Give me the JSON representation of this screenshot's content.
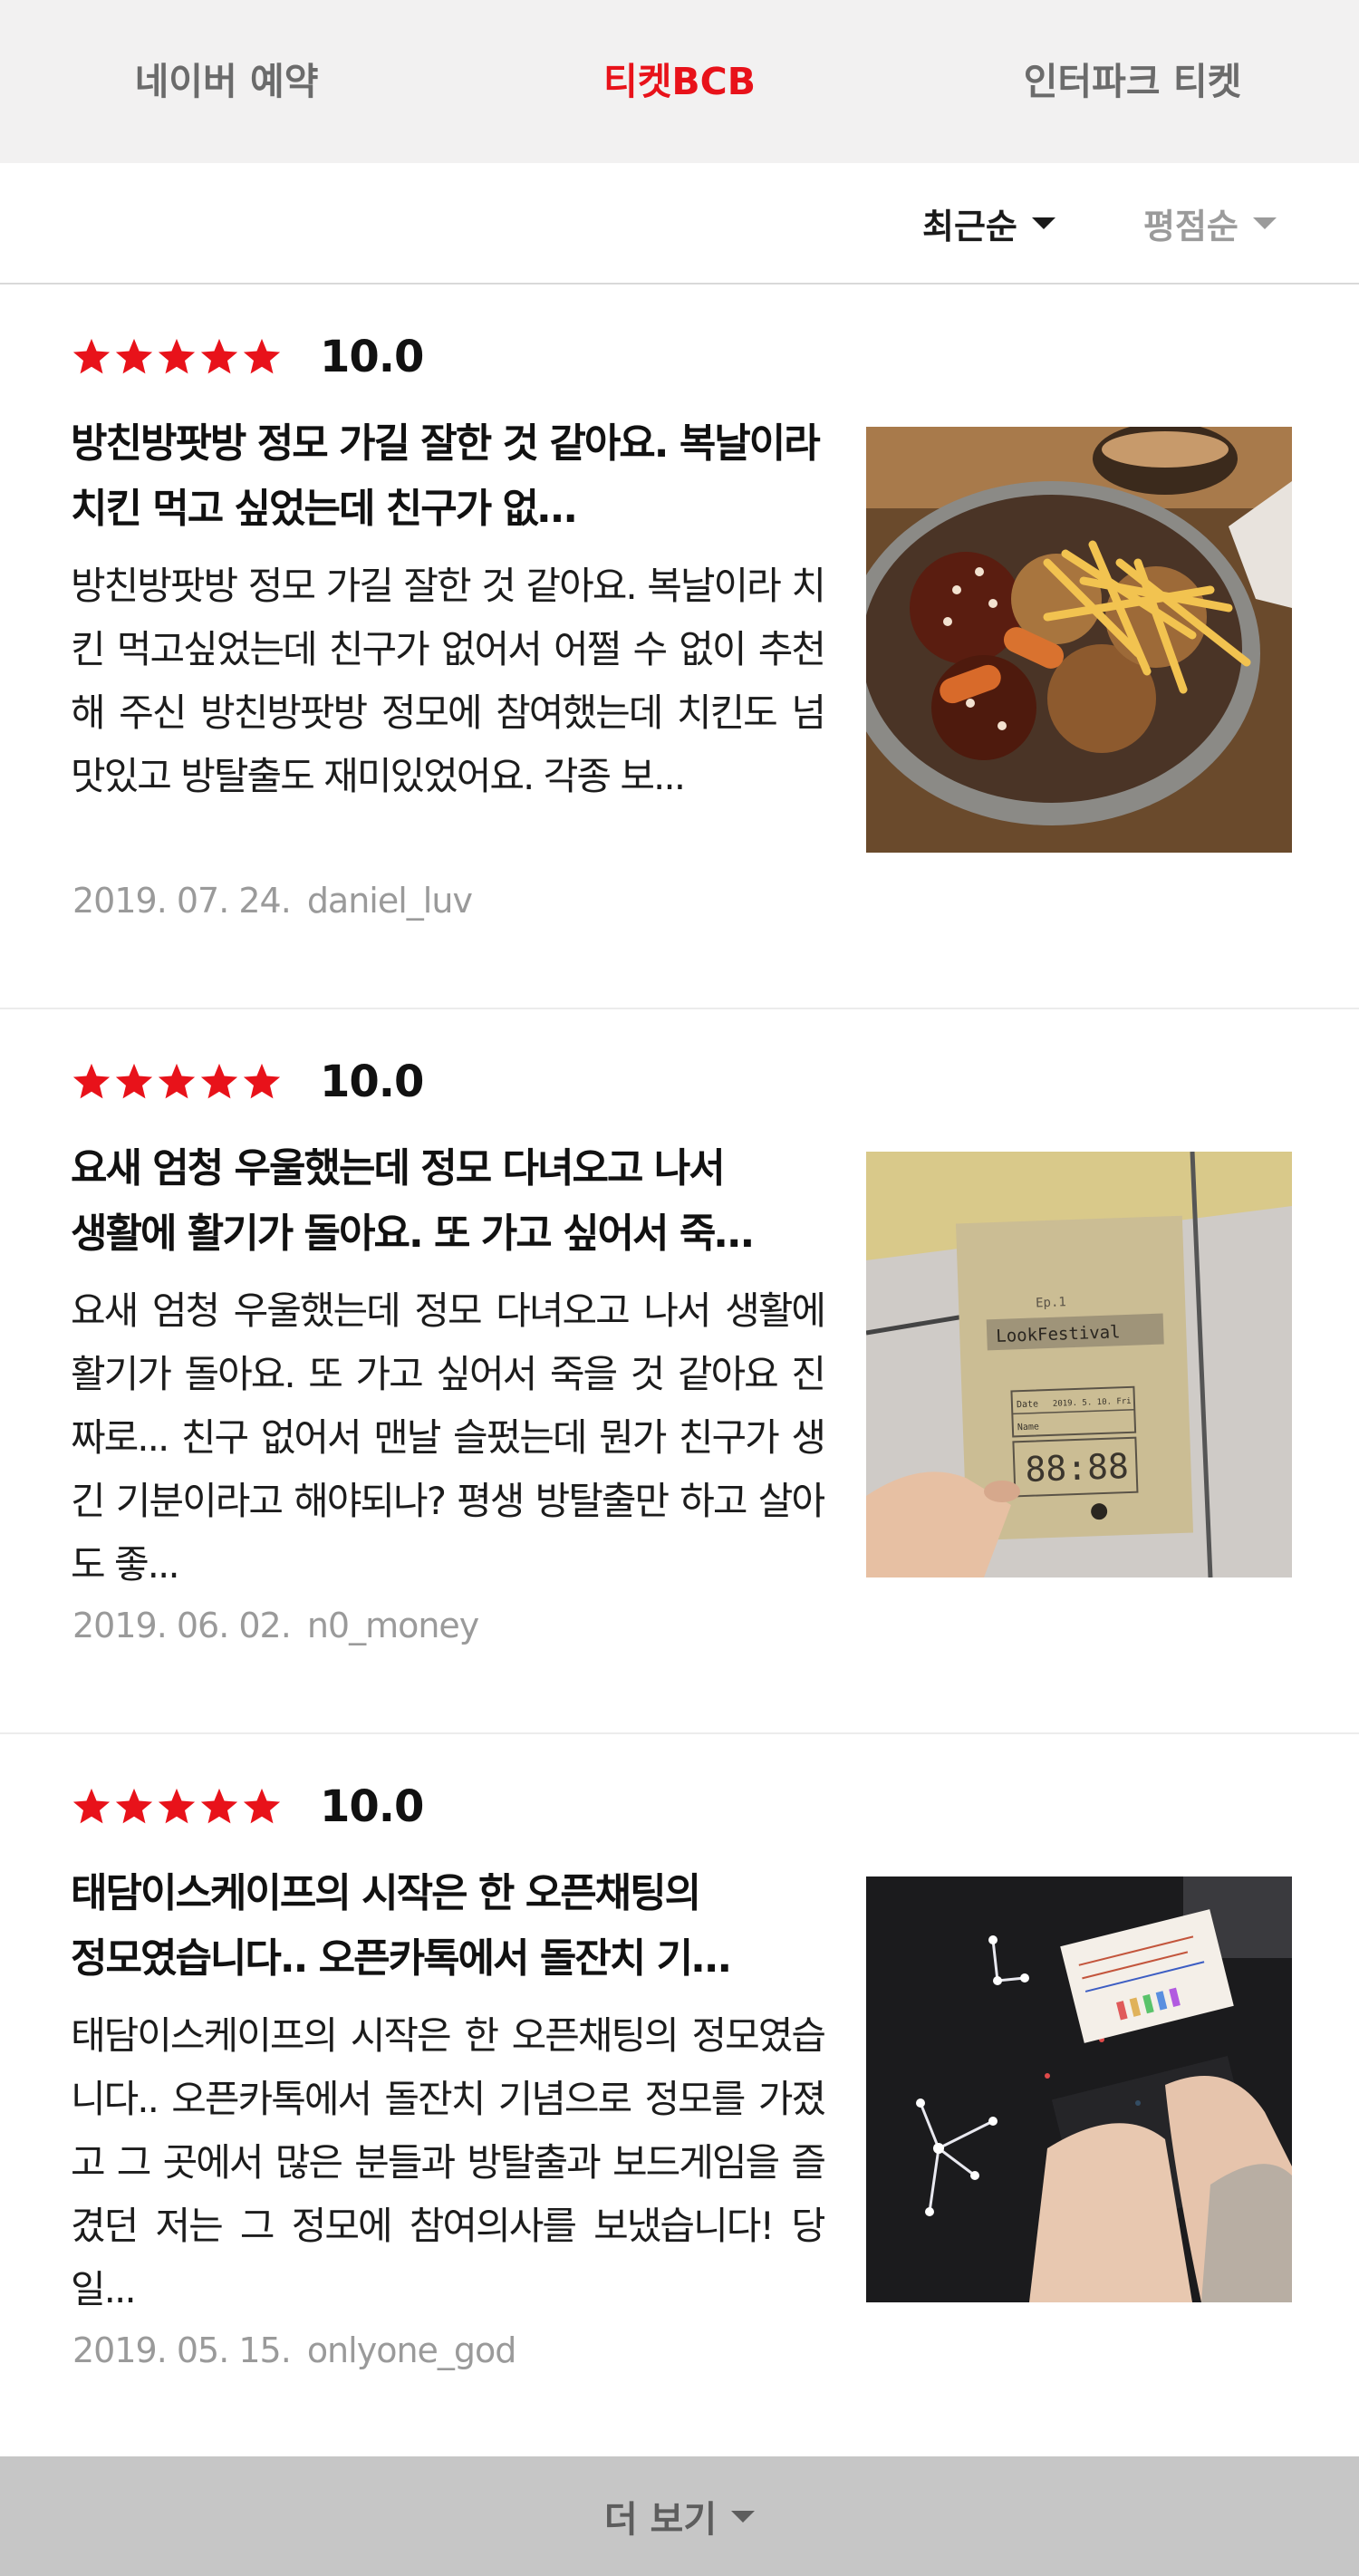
{
  "tabs": [
    {
      "label": "네이버 예약",
      "active": false
    },
    {
      "label": "티켓BCB",
      "active": true
    },
    {
      "label": "인터파크 티켓",
      "active": false
    }
  ],
  "sort": {
    "latest_label": "최근순",
    "rating_label": "평점순",
    "selected": "최근순"
  },
  "colors": {
    "accent": "#e8121a",
    "star": "#e8121a",
    "tab_bg": "#f2f1f1",
    "more_bg": "#c6c6c6"
  },
  "reviews": [
    {
      "stars": 5,
      "score": "10.0",
      "title": "방친방팟방 정모 가길 잘한 것 같아요. 복날이라 치킨 먹고 싶었는데 친구가 없…",
      "body": "방친방팟방 정모 가길 잘한 것 같아요. 복날이라 치킨 먹고싶었는데 친구가 없어서 어쩔 수 없이 추천해 주신 방친방팟방 정모에 참여했는데 치킨도 넘 맛있고 방탈출도 재미있었어요. 각종 보...",
      "date": "2019. 07. 24.",
      "user": "daniel_luv",
      "thumbnail_icon": "chicken-and-fries-photo"
    },
    {
      "stars": 5,
      "score": "10.0",
      "title": "요새 엄청 우울했는데 정모 다녀오고 나서 생활에 활기가 돌아요. 또 가고 싶어서 죽…",
      "body": "요새 엄청 우울했는데 정모 다녀오고 나서 생활에 활기가 돌아요. 또 가고 싶어서 죽을 것 같아요 진짜로... 친구 없어서 맨날 슬펐는데 뭔가 친구가 생긴 기분이라고 해야되나? 평생 방탈출만 하고 살아도 좋...",
      "date": "2019. 06. 02.",
      "user": "n0_money",
      "thumbnail_icon": "festival-card-photo",
      "thumbnail_text": {
        "line1": "Ep.1",
        "line2": "LookFestival",
        "date_label": "Date",
        "date_value": "2019. 5. 10. Fri",
        "name_label": "Name",
        "timer": "88:88"
      }
    },
    {
      "stars": 5,
      "score": "10.0",
      "title": "태담이스케이프의 시작은 한 오픈채팅의 정모였습니다.. 오픈카톡에서 돌잔치 기…",
      "body": "태담이스케이프의 시작은 한 오픈채팅의 정모였습니다.. 오픈카톡에서 돌잔치 기념으로 정모를 가졌고 그 곳에서 많은 분들과 방탈출과 보드게임을 즐겼던 저는 그 정모에 참여의사를 보냈습니다! 당일...",
      "date": "2019. 05. 15.",
      "user": "onlyone_god",
      "thumbnail_icon": "constellation-board-photo"
    }
  ],
  "more_label": "더 보기"
}
